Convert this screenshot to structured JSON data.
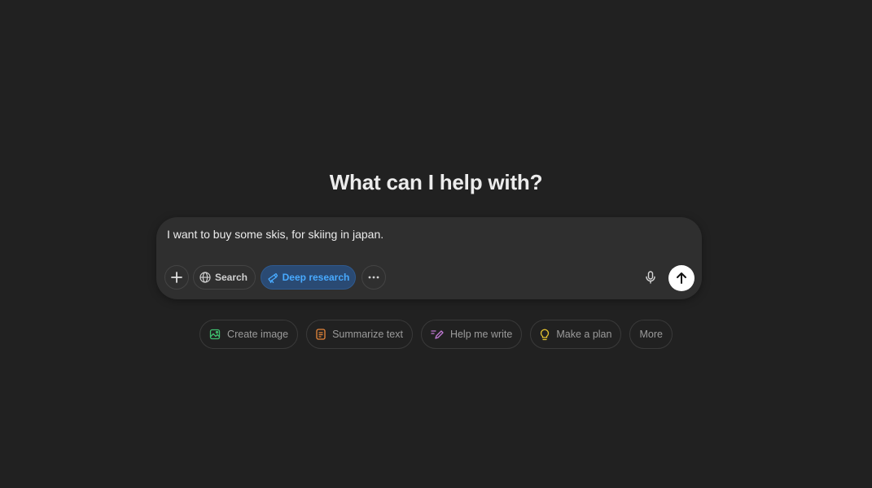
{
  "heading": "What can I help with?",
  "composer": {
    "input_value": "I want to buy some skis, for skiing in japan.",
    "tools": {
      "search_label": "Search",
      "deep_research_label": "Deep research"
    }
  },
  "suggestions": [
    {
      "label": "Create image",
      "icon": "image-icon",
      "color": "#3fbf6f"
    },
    {
      "label": "Summarize text",
      "icon": "document-icon",
      "color": "#e8873a"
    },
    {
      "label": "Help me write",
      "icon": "pen-icon",
      "color": "#c27ad6"
    },
    {
      "label": "Make a plan",
      "icon": "lightbulb-icon",
      "color": "#e2c12f"
    },
    {
      "label": "More",
      "icon": "",
      "color": ""
    }
  ],
  "colors": {
    "background": "#212121",
    "composer": "#2f2f2f",
    "deep_research_accent": "#48aaff",
    "deep_research_bg": "#2a4a73"
  }
}
